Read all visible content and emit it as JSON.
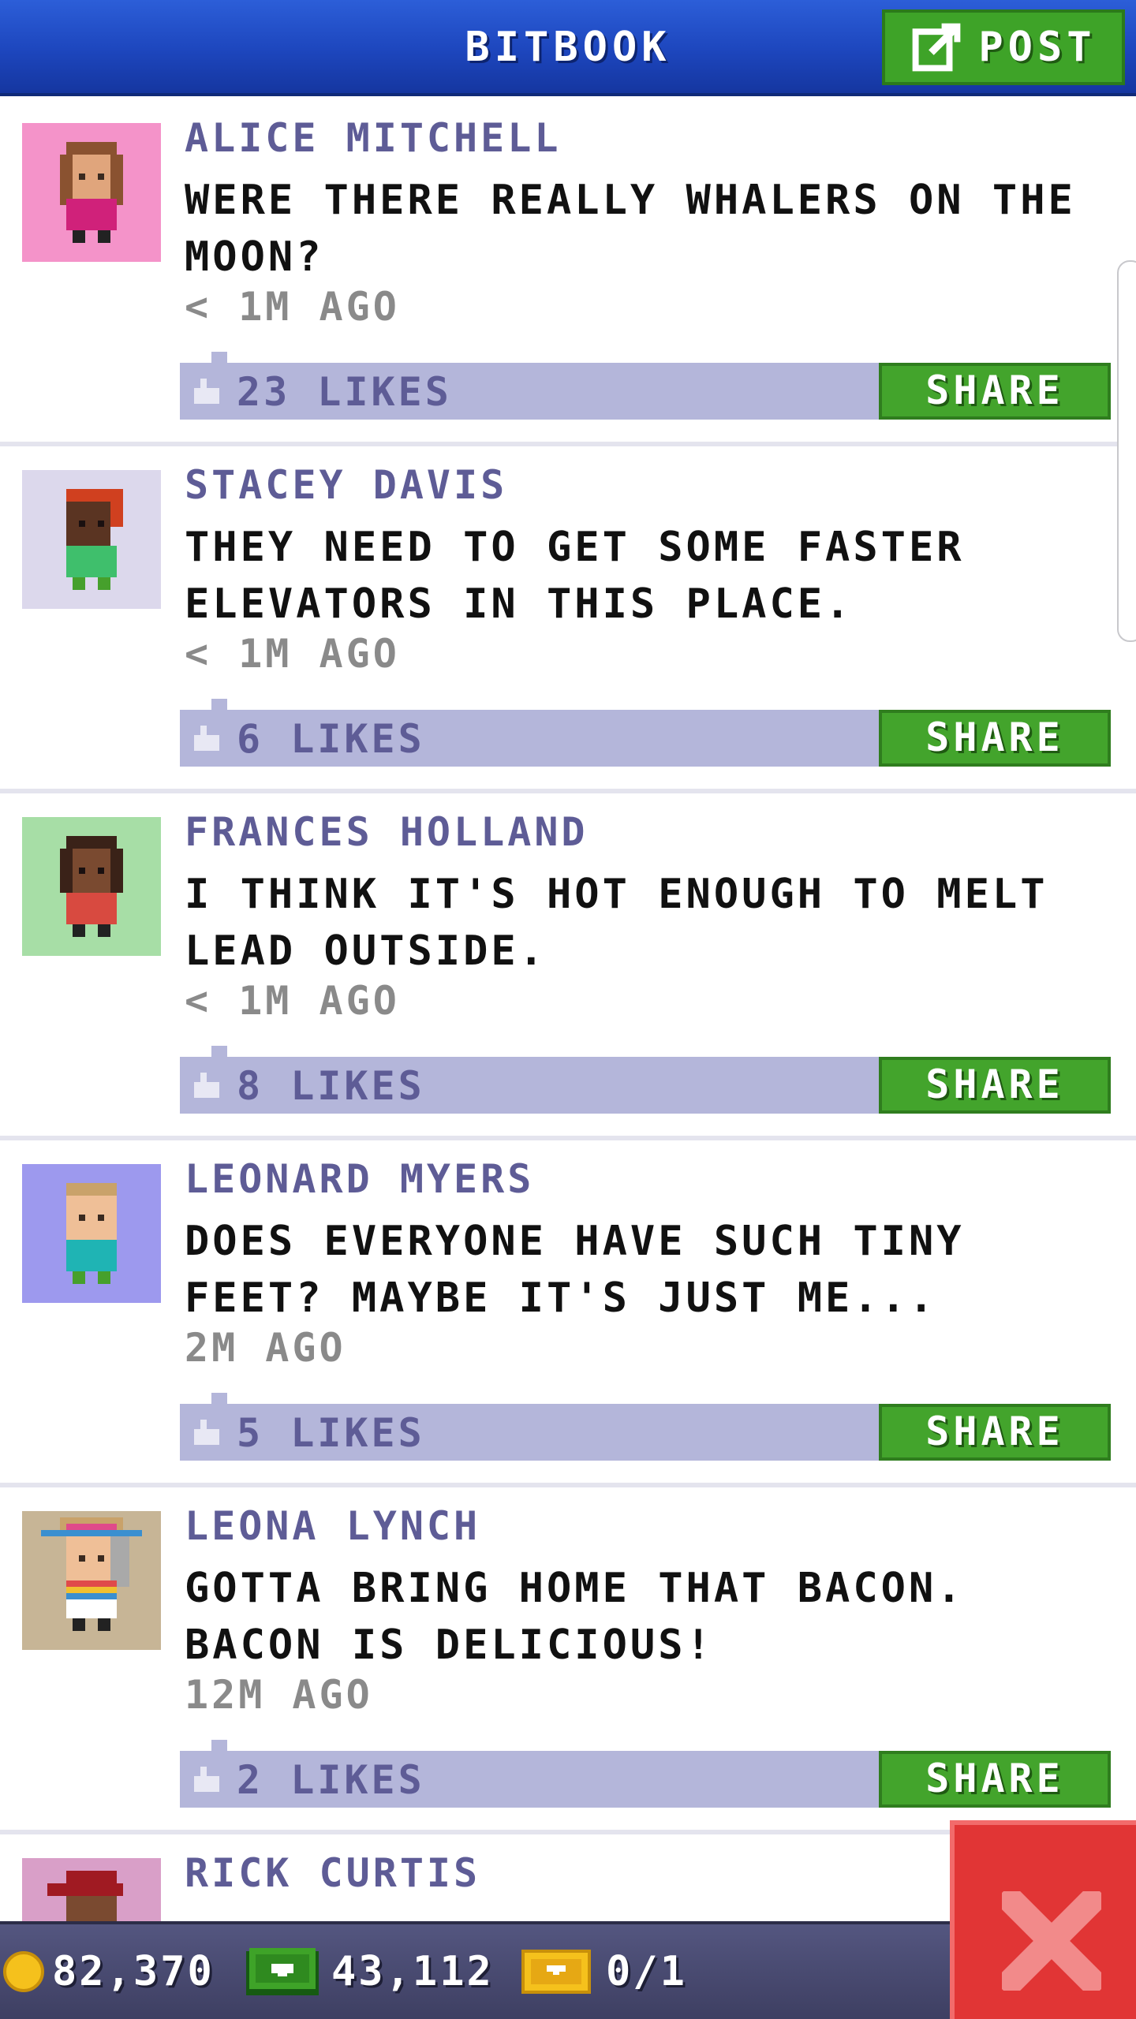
{
  "header": {
    "title": "BITBOOK",
    "post_label": "POST"
  },
  "posts": [
    {
      "author": "ALICE MITCHELL",
      "message": "WERE THERE REALLY WHALERS ON THE MOON?",
      "time": "< 1M AGO",
      "likes": "23 LIKES",
      "share": "SHARE",
      "avatar_bg": "#f493c9"
    },
    {
      "author": "STACEY DAVIS",
      "message": "THEY NEED TO GET SOME FASTER ELEVATORS IN THIS PLACE.",
      "time": "< 1M AGO",
      "likes": "6 LIKES",
      "share": "SHARE",
      "avatar_bg": "#dcd8ec"
    },
    {
      "author": "FRANCES HOLLAND",
      "message": "I THINK IT'S HOT ENOUGH TO MELT LEAD OUTSIDE.",
      "time": "< 1M AGO",
      "likes": "8 LIKES",
      "share": "SHARE",
      "avatar_bg": "#a7dea6"
    },
    {
      "author": "LEONARD MYERS",
      "message": "DOES EVERYONE HAVE SUCH TINY FEET? MAYBE IT'S JUST ME...",
      "time": "2M AGO",
      "likes": "5 LIKES",
      "share": "SHARE",
      "avatar_bg": "#9d99ee"
    },
    {
      "author": "LEONA LYNCH",
      "message": "GOTTA BRING HOME THAT BACON. BACON IS DELICIOUS!",
      "time": "12M AGO",
      "likes": "2 LIKES",
      "share": "SHARE",
      "avatar_bg": "#c7b596"
    }
  ],
  "partial_post": {
    "author": "RICK CURTIS",
    "avatar_bg": "#d99fc8"
  },
  "status": {
    "coins": "82,370",
    "bux": "43,112",
    "tickets": "0/1"
  },
  "icons": {
    "post": "compose-icon",
    "like": "thumbs-up-icon",
    "coin": "coin-icon",
    "bux": "bux-icon",
    "ticket": "golden-ticket-icon",
    "close": "close-icon"
  },
  "colors": {
    "header": "#1d46bd",
    "green_button": "#43a42c",
    "like_bar": "#b4b6da",
    "author_text": "#5e5c96",
    "close_button": "#e13535"
  }
}
